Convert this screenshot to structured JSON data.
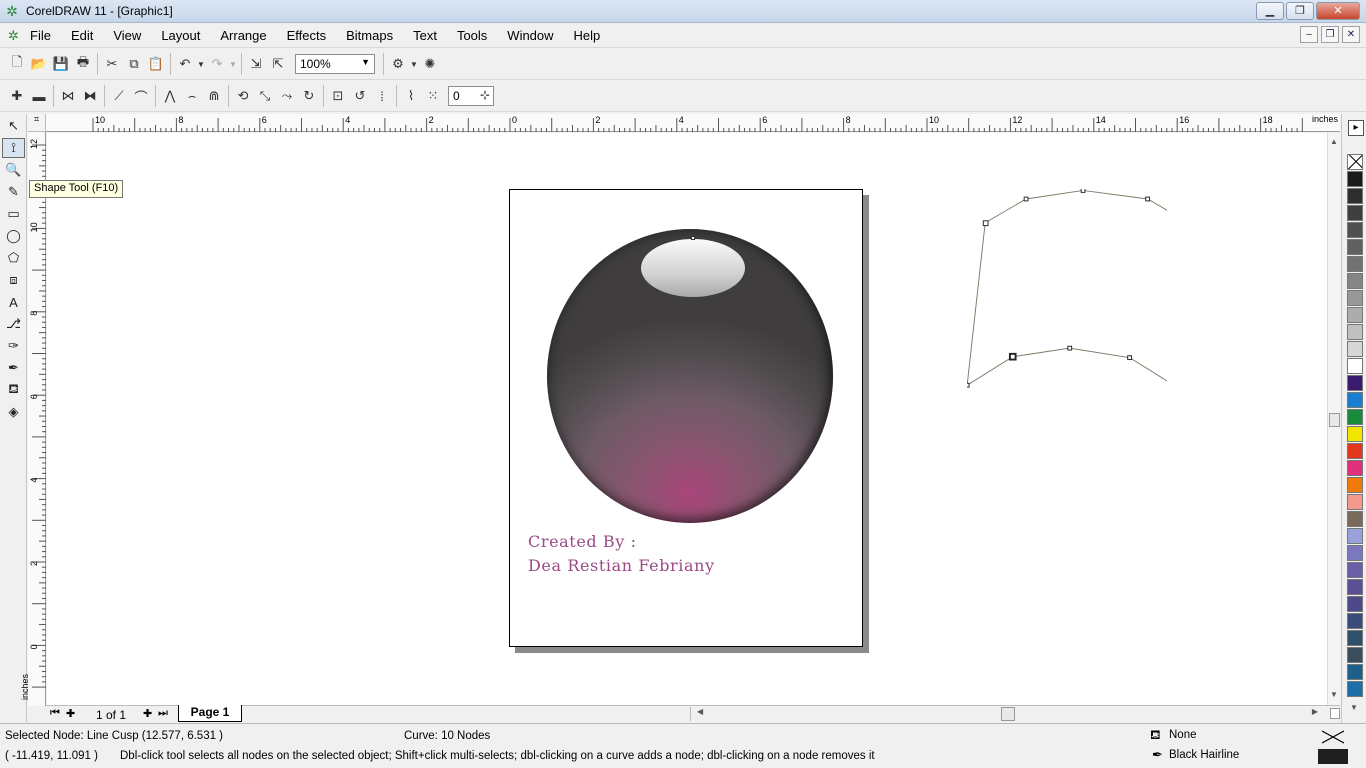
{
  "window": {
    "title": "CorelDRAW 11 - [Graphic1]",
    "buttons": {
      "minimize": "▁",
      "restore": "❐",
      "close": "✕"
    }
  },
  "menu": {
    "items": [
      "File",
      "Edit",
      "View",
      "Layout",
      "Arrange",
      "Effects",
      "Bitmaps",
      "Text",
      "Tools",
      "Window",
      "Help"
    ],
    "doc_buttons": {
      "minimize": "–",
      "restore": "❐",
      "close": "✕"
    }
  },
  "toolbar": {
    "zoom_value": "100%",
    "node_value": "0"
  },
  "tooltip": {
    "text": "Shape Tool (F10)"
  },
  "rulers": {
    "unit": "inches",
    "top_labels": [
      "10",
      "8",
      "6",
      "4",
      "2",
      "0",
      "2",
      "4",
      "6",
      "8",
      "10",
      "12",
      "14",
      "16",
      "18"
    ],
    "left_labels": [
      "12",
      "10",
      "8",
      "6",
      "4",
      "2",
      "0"
    ]
  },
  "canvas": {
    "credit_line1": "Created By :",
    "credit_line2": "Dea Restian Febriany"
  },
  "palette": {
    "colors": [
      "none",
      "#1a1a1a",
      "#2e2e2e",
      "#3f3f3f",
      "#505050",
      "#616161",
      "#727272",
      "#858585",
      "#989898",
      "#acacac",
      "#c0c0c0",
      "#d6d6d6",
      "#ffffff",
      "#3a1a6e",
      "#1b7fd1",
      "#1a8a3c",
      "#f2e600",
      "#e2361d",
      "#e0307a",
      "#f07b0a",
      "#f49a8c",
      "#7a6a5a",
      "#9aa0d8",
      "#7c78c0",
      "#6a5fa8",
      "#5c4f96",
      "#4e4a8a",
      "#3a4d7a",
      "#2f4f6a",
      "#3c4e5e",
      "#1f5f8e",
      "#1e6fa8"
    ]
  },
  "pages": {
    "count": "1 of 1",
    "tab_label": "Page 1"
  },
  "status": {
    "selected_node": "Selected Node: Line Cusp (12.577, 6.531 )",
    "curve_info": "Curve: 10 Nodes",
    "coordinates": "( -11.419, 11.091 )",
    "hint": "Dbl-click tool selects all nodes on the selected object; Shift+click multi-selects; dbl-clicking on a curve adds a node; dbl-clicking on a node removes it",
    "fill_label": "None",
    "outline_label": "Black  Hairline"
  }
}
